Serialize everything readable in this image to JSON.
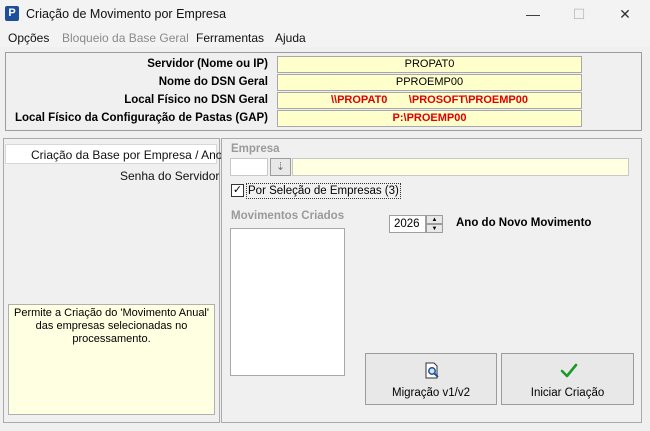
{
  "window": {
    "app_icon_letter": "P",
    "title": "Criação de Movimento por Empresa",
    "minimize_glyph": "—",
    "maximize_glyph": "☐",
    "close_glyph": "✕"
  },
  "menu": [
    {
      "label": "Opções",
      "enabled": true
    },
    {
      "label": "Bloqueio da Base Geral",
      "enabled": false
    },
    {
      "label": "Ferramentas",
      "enabled": true
    },
    {
      "label": "Ajuda",
      "enabled": true
    }
  ],
  "config": {
    "rows": [
      {
        "label": "Servidor (Nome ou IP)",
        "value": "PROPAT0"
      },
      {
        "label": "Nome do DSN Geral",
        "value": "PPROEMP00"
      },
      {
        "label": "Local Físico no DSN Geral",
        "value": "\\\\PROPAT0       \\PROSOFT\\PROEMP00"
      },
      {
        "label": "Local Físico da Configuração de Pastas (GAP)",
        "value": "P:\\PROEMP00"
      }
    ]
  },
  "nav": {
    "items": [
      {
        "label": "Criação da Base por Empresa / Ano",
        "selected": true
      },
      {
        "label": "Senha do Servidor",
        "selected": false
      }
    ],
    "info_text": "Permite a Criação do 'Movimento Anual' das empresas selecionadas no processamento."
  },
  "main": {
    "empresa_label": "Empresa",
    "empresa_code": "",
    "empresa_name": "",
    "lookup_glyph": "⇣",
    "checkbox_label": "Por Seleção de Empresas (3)",
    "checkbox_checked": true,
    "movimentos_label": "Movimentos Criados",
    "movimentos_items": [],
    "year_value": "2026",
    "year_label": "Ano do Novo Movimento",
    "migracao_label": "Migração v1/v2",
    "iniciar_label": "Iniciar Criação"
  },
  "colors": {
    "highlight_red": "#e00000",
    "field_yellow": "#ffffcc",
    "info_yellow": "#ffffe1",
    "check_green": "#1a9a2a"
  }
}
